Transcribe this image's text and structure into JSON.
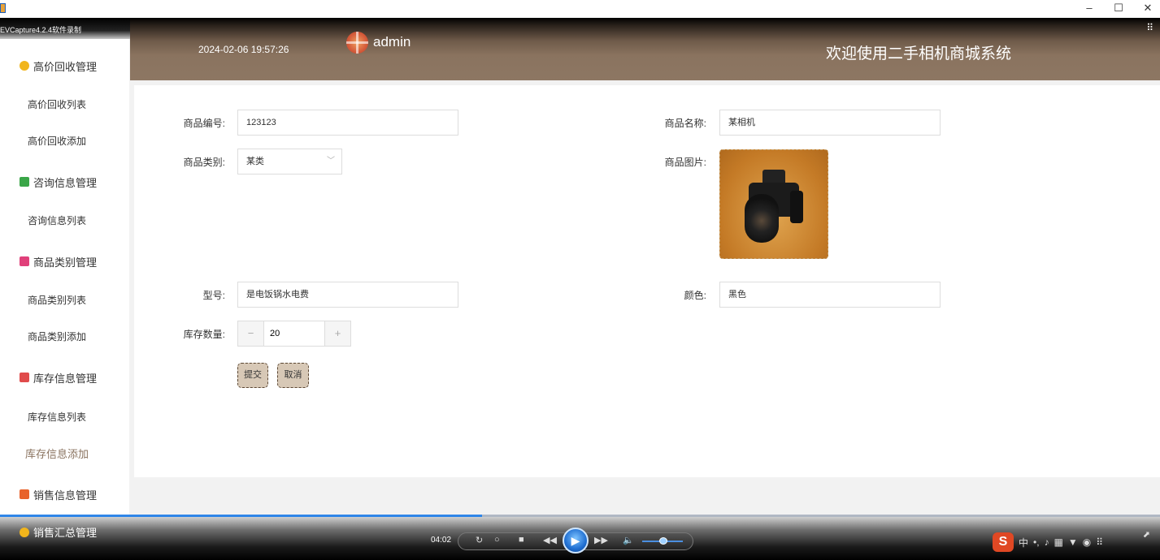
{
  "player": {
    "title": "EVCapture4.2.4软件录制",
    "time": "04:02"
  },
  "header": {
    "datetime": "2024-02-06 19:57:26",
    "username": "admin",
    "system_title": "欢迎使用二手相机商城系统"
  },
  "sidebar": {
    "groups": [
      {
        "label": "高价回收管理",
        "icon_color": "#f1b51c"
      },
      {
        "label": "咨询信息管理",
        "icon_color": "#3aa648"
      },
      {
        "label": "商品类别管理",
        "icon_color": "#e0407a"
      },
      {
        "label": "库存信息管理",
        "icon_color": "#e04b4b"
      },
      {
        "label": "销售信息管理",
        "icon_color": "#e8622a"
      },
      {
        "label": "销售汇总管理",
        "icon_color": "#f1b51c"
      }
    ],
    "items": [
      "高价回收列表",
      "高价回收添加",
      "咨询信息列表",
      "商品类别列表",
      "商品类别添加",
      "库存信息列表",
      "库存信息添加"
    ]
  },
  "form": {
    "product_no_label": "商品编号:",
    "product_no_value": "123123",
    "product_name_label": "商品名称:",
    "product_name_value": "某相机",
    "category_label": "商品类别:",
    "category_value": "某类",
    "image_label": "商品图片:",
    "model_label": "型号:",
    "model_value": "是电饭锅水电费",
    "color_label": "颜色:",
    "color_value": "黑色",
    "stock_label": "库存数量:",
    "stock_value": "20",
    "submit_label": "提交",
    "cancel_label": "取消"
  },
  "colors": {
    "accent": "#8a735f",
    "button_bg": "#d7c8b6"
  }
}
